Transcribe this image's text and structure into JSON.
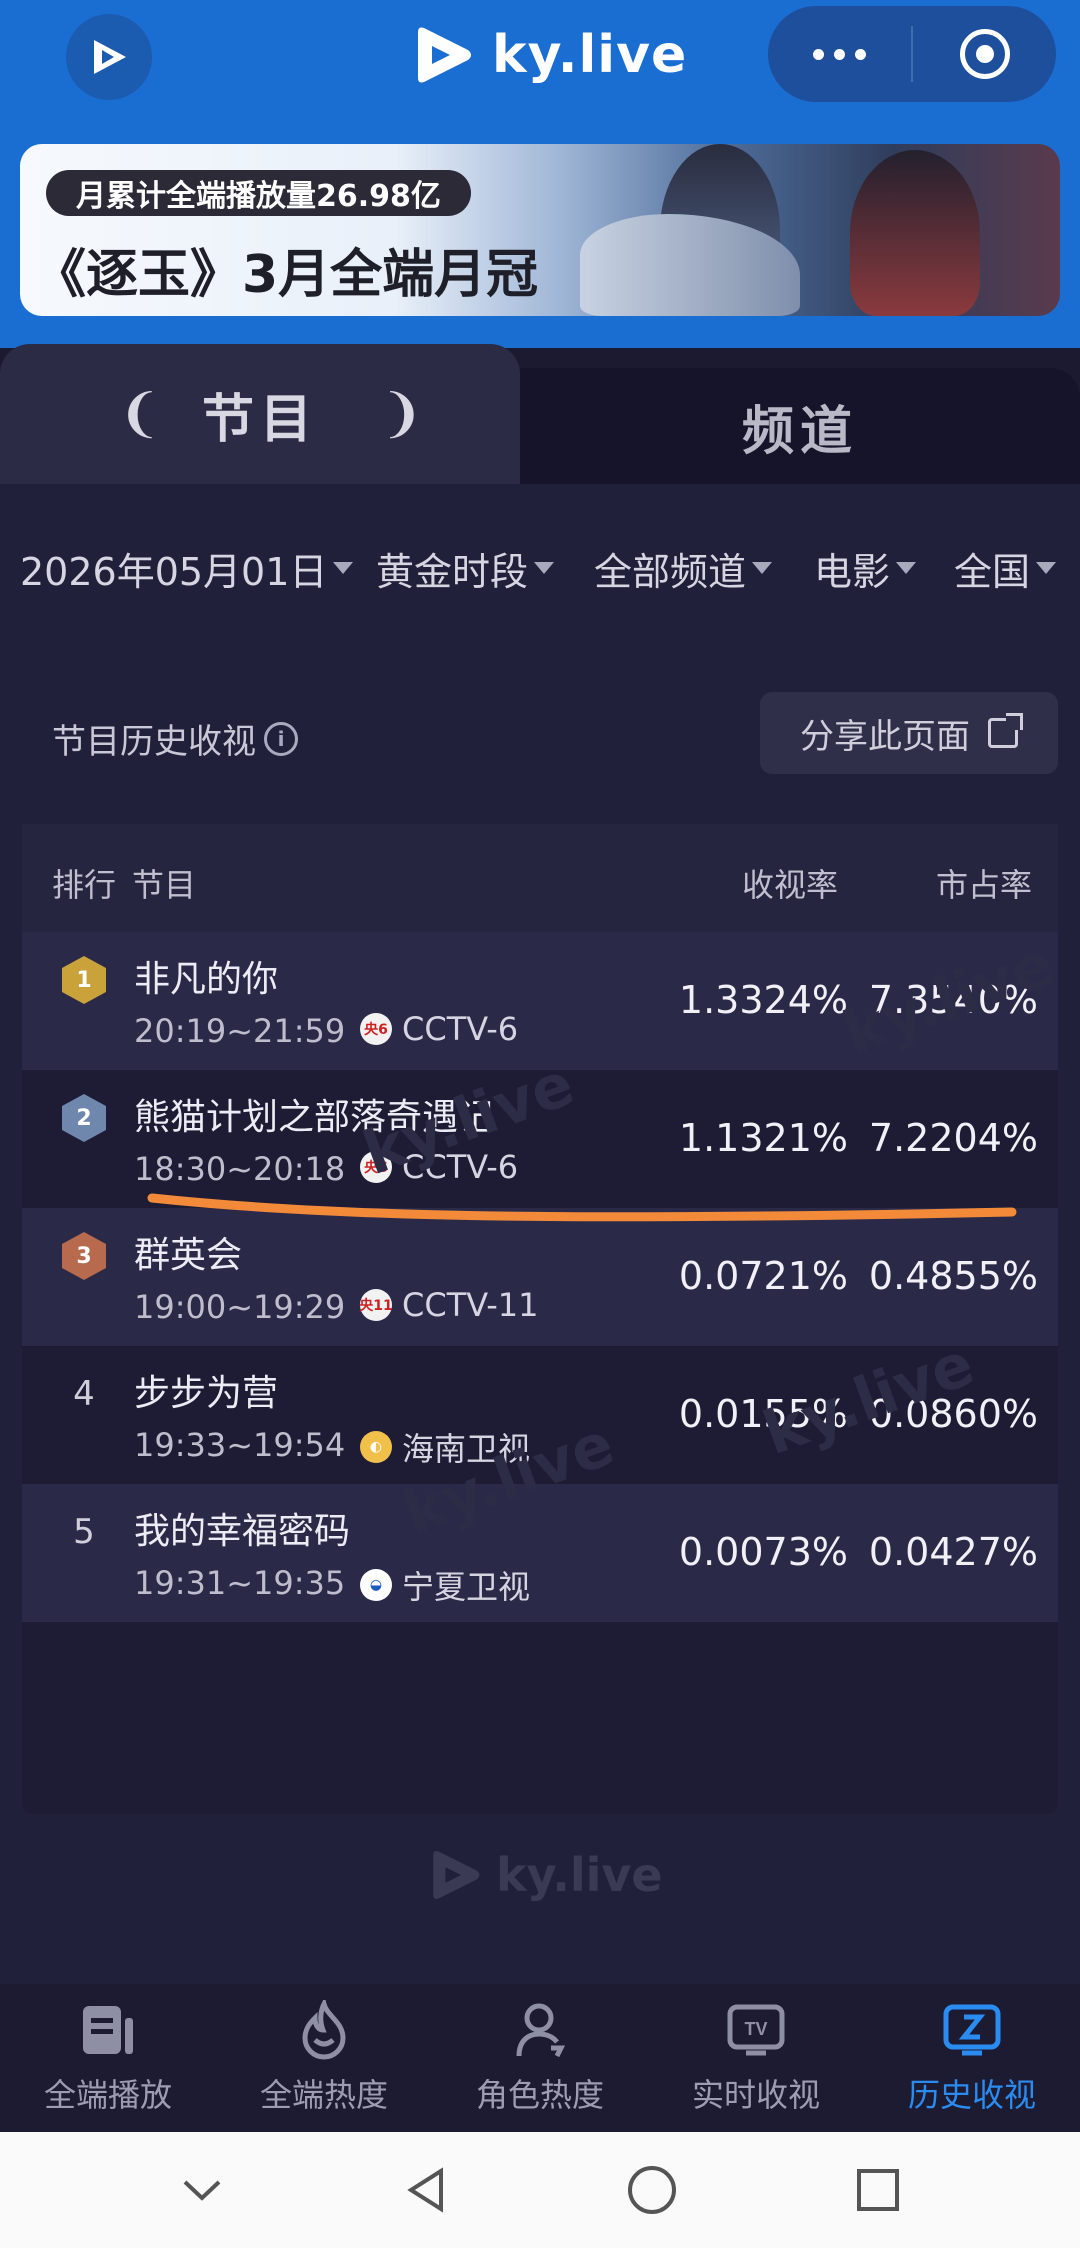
{
  "app": {
    "brand": "ky.live"
  },
  "banner": {
    "pill_text": "月累计全端播放量26.98亿",
    "title": "《逐玉》3月全端月冠"
  },
  "tabs": [
    {
      "label": "节目",
      "active": true
    },
    {
      "label": "频道",
      "active": false
    }
  ],
  "filters": [
    {
      "label": "2026年05月01日"
    },
    {
      "label": "黄金时段"
    },
    {
      "label": "全部频道"
    },
    {
      "label": "电影"
    },
    {
      "label": "全国"
    }
  ],
  "section": {
    "title": "节目历史收视",
    "share_label": "分享此页面"
  },
  "table": {
    "headers": {
      "rank": "排行",
      "program": "节目",
      "rating": "收视率",
      "share": "市占率"
    },
    "rows": [
      {
        "rank": "1",
        "name": "非凡的你",
        "time": "20:19~21:59",
        "channel_icon": "央6",
        "channel": "CCTV-6",
        "rating": "1.3324%",
        "share": "7.3540%"
      },
      {
        "rank": "2",
        "name": "熊猫计划之部落奇遇记",
        "time": "18:30~20:18",
        "channel_icon": "央6",
        "channel": "CCTV-6",
        "rating": "1.1321%",
        "share": "7.2204%"
      },
      {
        "rank": "3",
        "name": "群英会",
        "time": "19:00~19:29",
        "channel_icon": "央11",
        "channel": "CCTV-11",
        "rating": "0.0721%",
        "share": "0.4855%"
      },
      {
        "rank": "4",
        "name": "步步为营",
        "time": "19:33~19:54",
        "channel_icon": "hainan-logo-icon",
        "channel": "海南卫视",
        "rating": "0.0155%",
        "share": "0.0860%"
      },
      {
        "rank": "5",
        "name": "我的幸福密码",
        "time": "19:31~19:35",
        "channel_icon": "ningxia-logo-icon",
        "channel": "宁夏卫视",
        "rating": "0.0073%",
        "share": "0.0427%"
      }
    ]
  },
  "bottom_nav": [
    {
      "label": "全端播放",
      "icon": "play-list-icon",
      "active": false
    },
    {
      "label": "全端热度",
      "icon": "flame-icon",
      "active": false
    },
    {
      "label": "角色热度",
      "icon": "person-icon",
      "active": false
    },
    {
      "label": "实时收视",
      "icon": "tv-icon",
      "active": false
    },
    {
      "label": "历史收视",
      "icon": "history-rating-icon",
      "active": true
    }
  ],
  "colors": {
    "header_blue": "#1a6ed2",
    "active_nav": "#2a8bf0",
    "gold": "#c9a23a",
    "silver": "#6f86ad",
    "bronze": "#b86a4e",
    "annotation": "#f28a3a"
  }
}
